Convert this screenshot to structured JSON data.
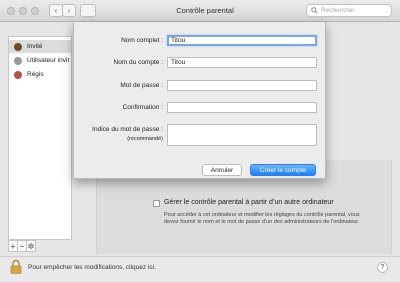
{
  "window": {
    "title": "Contrôle parental"
  },
  "toolbar": {
    "search_placeholder": "Rechercher",
    "back": "‹",
    "forward": "›",
    "grid": "⋮⋮⋮"
  },
  "sidebar": {
    "users": [
      {
        "name": "Invité",
        "avatar_color": "#6b4a2b"
      },
      {
        "name": "Utilisateur invit",
        "avatar_color": "#9a9a9a"
      },
      {
        "name": "Régis",
        "avatar_color": "#b5524a"
      }
    ],
    "controls": {
      "add": "+",
      "remove": "−",
      "gear": "✲"
    }
  },
  "remote": {
    "label": "Gérer le contrôle parental à partir d’un autre ordinateur",
    "description": "Pour accéder à cet ordinateur et modifier les réglages du contrôle parental, vous devez fournir le nom et le mot de passe d’un des administrateurs de l’ordinateur."
  },
  "bottom": {
    "lock_text": "Pour empêcher les modifications, cliquez ici.",
    "help": "?"
  },
  "sheet": {
    "full_name_label": "Nom complet :",
    "full_name_value": "Titou",
    "account_name_label": "Nom du compte :",
    "account_name_value": "Titou",
    "password_label": "Mot de passe :",
    "confirm_label": "Confirmation :",
    "hint_label": "Indice du mot de passe :",
    "hint_sub": "(recommandé)",
    "cancel": "Annuler",
    "create": "Créer le compte"
  },
  "colors": {
    "accent": "#1a82fb",
    "focus_ring": "#79a6e6"
  }
}
